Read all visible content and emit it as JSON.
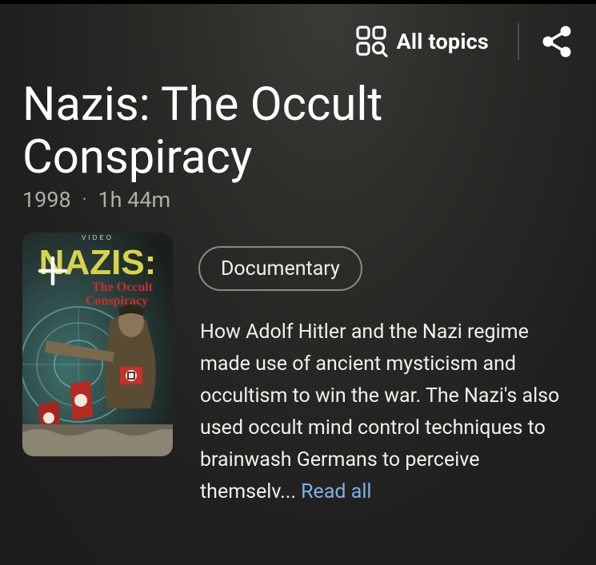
{
  "header": {
    "all_topics_label": "All topics",
    "all_topics_icon": "topics-grid-search-icon",
    "share_icon": "share-icon"
  },
  "movie": {
    "title": "Nazis: The Occult Conspiracy",
    "year": "1998",
    "separator": "·",
    "duration": "1h 44m",
    "genre": "Documentary",
    "description": "How Adolf Hitler and the Nazi regime made use of ancient mysticism and occultism to win the war. The Nazi's also used occult mind control techniques to brainwash Germans to perceive themselv...",
    "read_all_label": "Read all"
  },
  "poster": {
    "top_text": "VIDEO",
    "title_text": "NAZIS:",
    "subtitle_line1": "The Occult",
    "subtitle_line2": "Conspiracy",
    "add_icon": "plus-icon"
  },
  "colors": {
    "link": "#7fb0ec",
    "poster_title": "#d9d24a",
    "poster_subtitle": "#c8302a"
  }
}
